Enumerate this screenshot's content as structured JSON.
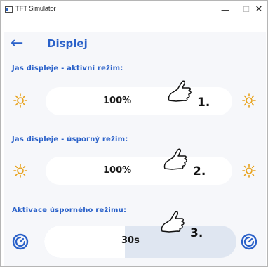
{
  "window": {
    "title": "TFT Simulator",
    "minimize": "—",
    "maximize": "☐",
    "close": "✕"
  },
  "header": {
    "back_icon": "←",
    "title": "Displej"
  },
  "colors": {
    "accent": "#2a61c9",
    "sun": "#e8a21a",
    "track": "#dfe6f1"
  },
  "sections": {
    "active": {
      "label": "Jas displeje - aktivní režim:",
      "value": "100%",
      "callout": "1."
    },
    "saving": {
      "label": "Jas displeje - úsporný režim:",
      "value": "100%",
      "callout": "2."
    },
    "timeout": {
      "label": "Aktivace úsporného režimu:",
      "value": "30s",
      "callout": "3.",
      "fill_fraction": 0.42
    }
  },
  "icons": {
    "brightness": "sun-icon",
    "timer": "timer-icon",
    "pointer": "hand-pointer-icon"
  }
}
